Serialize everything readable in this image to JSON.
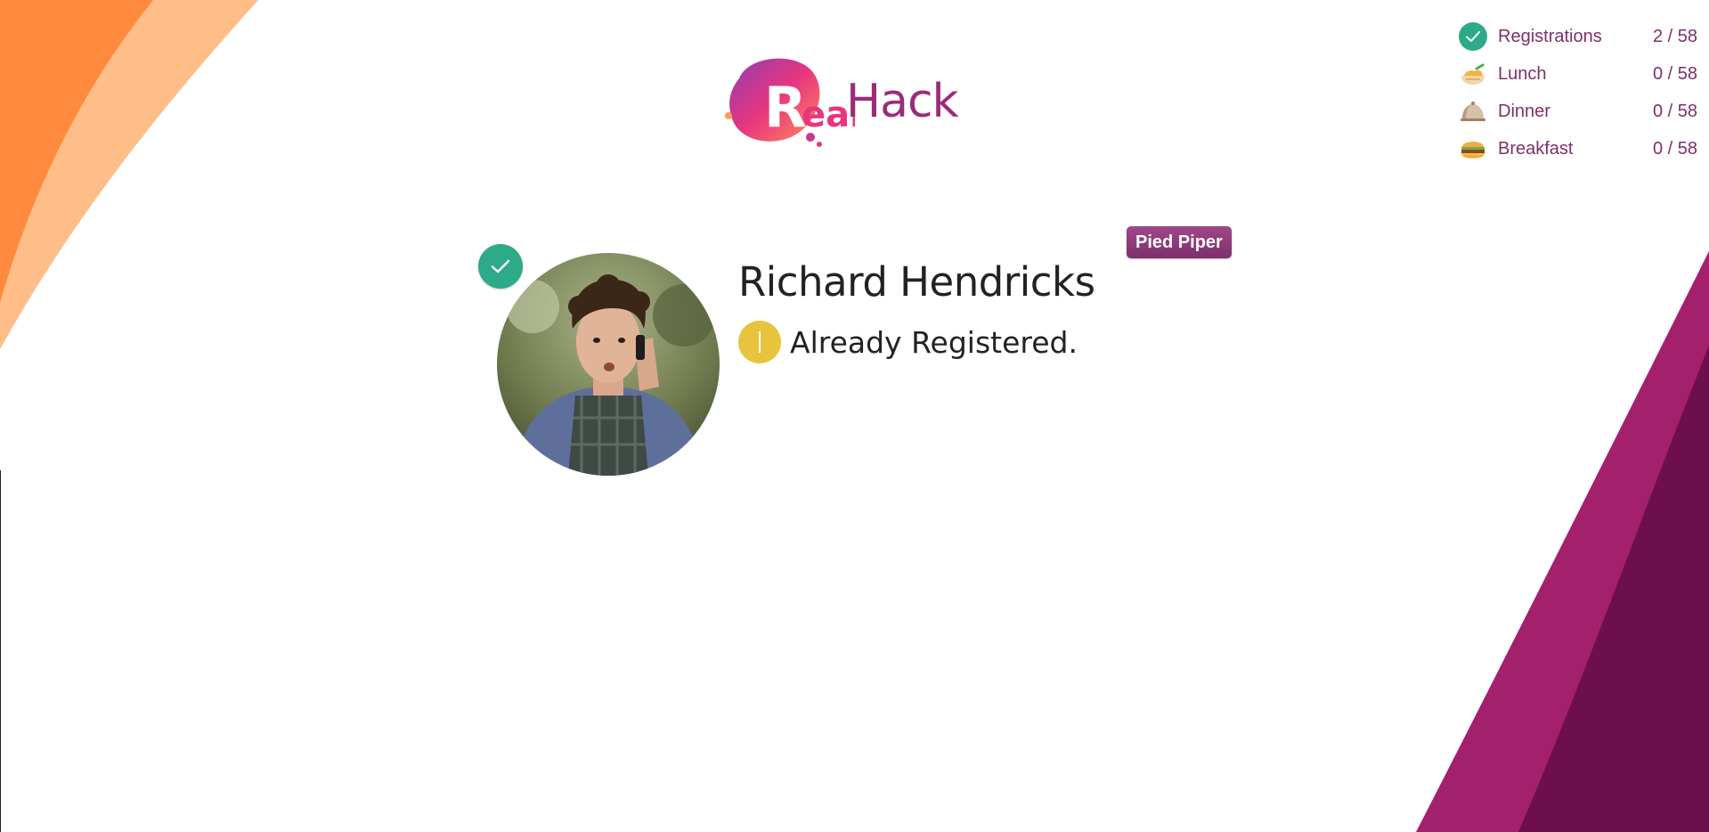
{
  "app": {
    "brand_text": "Hack",
    "logo_letters": "Real"
  },
  "stats": [
    {
      "icon": "check-circle-icon",
      "label": "Registrations",
      "value": "2 / 58"
    },
    {
      "icon": "noodles-icon",
      "label": "Lunch",
      "value": "0 / 58"
    },
    {
      "icon": "cloche-icon",
      "label": "Dinner",
      "value": "0 / 58"
    },
    {
      "icon": "burger-icon",
      "label": "Breakfast",
      "value": "0 / 58"
    }
  ],
  "attendee": {
    "name": "Richard Hendricks",
    "status": "Already Registered.",
    "team": "Pied Piper",
    "verified": true
  },
  "colors": {
    "accent": "#7d2f6b",
    "success": "#2daa87",
    "warning": "#e7c43c",
    "orange": "#ff8a3d",
    "peach": "#ffbd88",
    "magenta": "#a3206c",
    "plum": "#6d0f4c"
  }
}
